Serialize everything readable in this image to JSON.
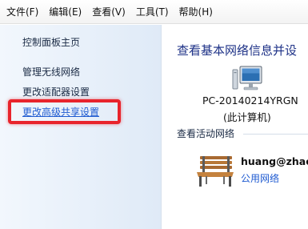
{
  "menubar": {
    "items": [
      "文件(F)",
      "编辑(E)",
      "查看(V)",
      "工具(T)",
      "帮助(H)"
    ]
  },
  "sidebar": {
    "home": "控制面板主页",
    "links": [
      "管理无线网络",
      "更改适配器设置",
      "更改高级共享设置"
    ]
  },
  "main": {
    "title": "查看基本网络信息并设",
    "computer": {
      "icon": "computer-icon",
      "name": "PC-20140214YRGN",
      "subtitle": "(此计算机)"
    },
    "active_networks_heading": "查看活动网络",
    "network": {
      "icon": "bench-icon",
      "name": "huang@zhao",
      "type": "公用网络"
    }
  },
  "colors": {
    "link": "#1f5bd1",
    "title": "#1e3287",
    "highlight": "#e8242c"
  }
}
